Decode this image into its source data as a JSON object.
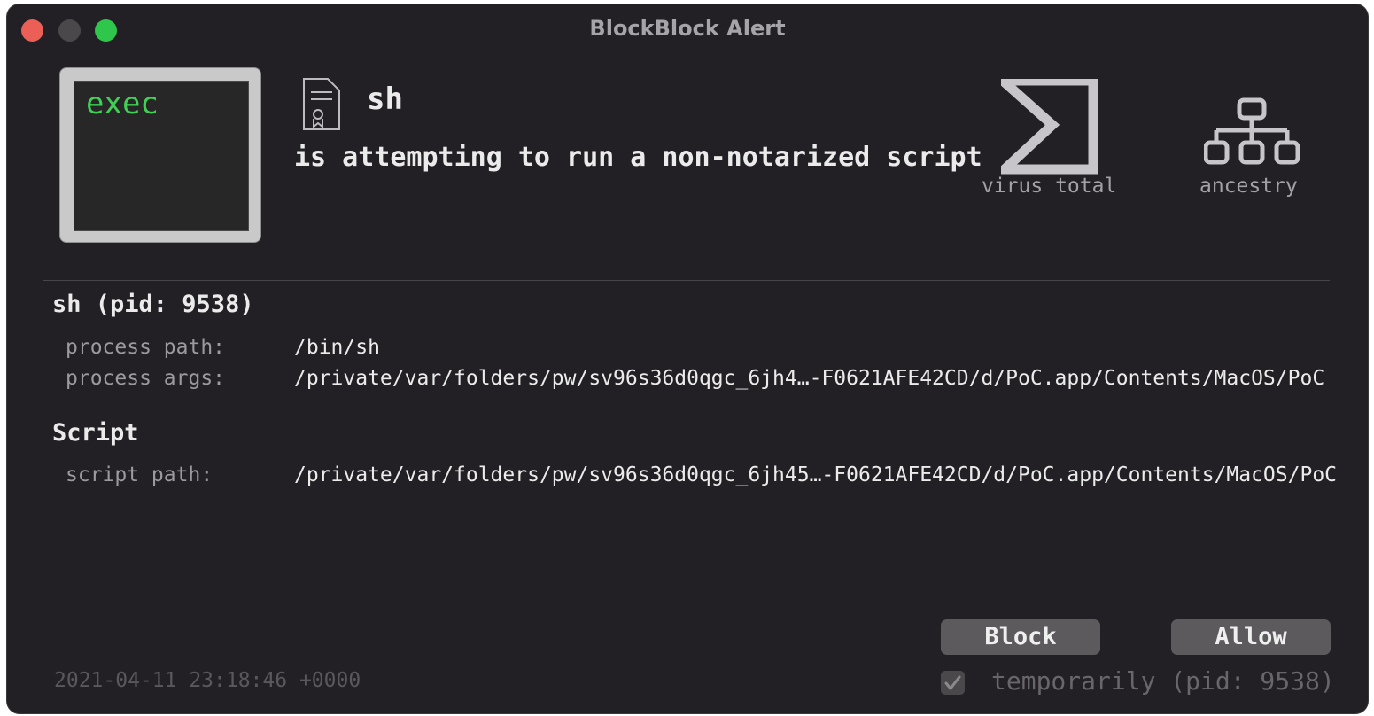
{
  "window": {
    "title": "BlockBlock Alert"
  },
  "alert": {
    "type_tile": "exec",
    "process_name": "sh",
    "message": "is attempting to run a non-notarized script"
  },
  "tools": {
    "virus_total_label": "virus total",
    "ancestry_label": "ancestry"
  },
  "process": {
    "heading": "sh (pid: 9538)",
    "path_label": "process path:",
    "path_value": "/bin/sh",
    "args_label": "process args:",
    "args_value": "/private/var/folders/pw/sv96s36d0qgc_6jh4…-F0621AFE42CD/d/PoC.app/Contents/MacOS/PoC"
  },
  "script": {
    "heading": "Script",
    "path_label": "script path:",
    "path_value": "/private/var/folders/pw/sv96s36d0qgc_6jh45…-F0621AFE42CD/d/PoC.app/Contents/MacOS/PoC"
  },
  "footer": {
    "timestamp": "2021-04-11 23:18:46 +0000",
    "block_label": "Block",
    "allow_label": "Allow",
    "temporarily_label": "temporarily (pid: 9538)",
    "temporarily_checked": true
  },
  "colors": {
    "window_bg": "#232025",
    "exec_green": "#3fd055",
    "button_bg": "#5d5a5e"
  }
}
